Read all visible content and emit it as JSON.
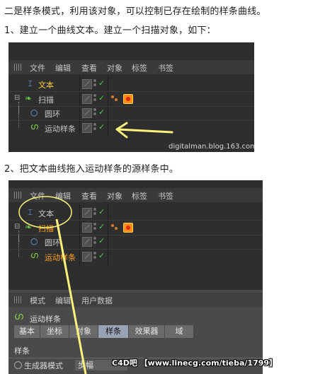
{
  "paragraphs": {
    "intro": "二是样条模式，利用该对象，可以控制已存在绘制的样条曲线。",
    "step1": "1、建立一个曲线文本。建立一个扫描对象，如下：",
    "step2": "2、把文本曲线拖入运动样条的源样条中。"
  },
  "screenshot1": {
    "menu": [
      "文件",
      "编辑",
      "查看",
      "对象",
      "标签",
      "书签"
    ],
    "objects": [
      {
        "name": "文本",
        "color": "#ffcc33"
      },
      {
        "name": "扫描",
        "color": "#c8c8c8"
      },
      {
        "name": "圆环",
        "color": "#c8c8c8"
      },
      {
        "name": "运动样条",
        "color": "#c8c8c8"
      }
    ],
    "watermark": "digitalman.blog.163.com"
  },
  "screenshot2": {
    "menu": [
      "文件",
      "编辑",
      "查看",
      "对象",
      "标签",
      "书签"
    ],
    "objects": [
      {
        "name": "文本",
        "color": "#c8c8c8"
      },
      {
        "name": "扫描",
        "color": "#ffa020"
      },
      {
        "name": "圆环",
        "color": "#c8c8c8"
      },
      {
        "name": "运动样条",
        "color": "#ffa020"
      }
    ],
    "attr_menu": [
      "模式",
      "编辑",
      "用户数据"
    ],
    "attr_title": "运动样条",
    "tabs": [
      "基本",
      "坐标",
      "对象",
      "样条",
      "效果器",
      "域"
    ],
    "active_tab": "样条",
    "section": "样条",
    "generator_label": "生成器模式",
    "generator_value": "步幅"
  },
  "watermark2": "C4D吧 【www.linecg.com/tieba/1799】",
  "colors": {
    "annotation": "#fff27a",
    "check": "#4fd04f"
  }
}
